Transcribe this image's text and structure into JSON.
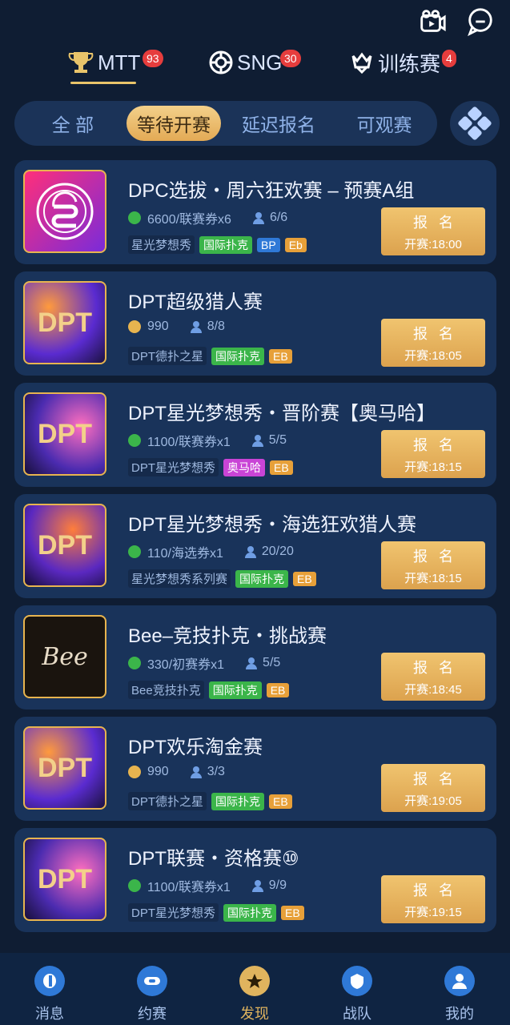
{
  "top": {
    "icons": [
      "camera-icon",
      "message-icon"
    ]
  },
  "tabs": [
    {
      "label": "MTT",
      "badge": "93"
    },
    {
      "label": "SNG",
      "badge": "30"
    },
    {
      "label": "训练赛",
      "badge": "4"
    }
  ],
  "filters": [
    "全  部",
    "等待开赛",
    "延迟报名",
    "可观赛"
  ],
  "cards": [
    {
      "title": "DPC选拔・周六狂欢赛 – 预赛A组",
      "meta": "6600/联赛券x6",
      "people": "6/6",
      "org": "星光梦想秀",
      "tags": [
        "国际扑克",
        "BP",
        "Eb"
      ],
      "btn": "报名",
      "time": "开赛:18:00"
    },
    {
      "title": "DPT超级猎人赛",
      "meta": "990",
      "people": "8/8",
      "org": "DPT德扑之星",
      "tags": [
        "国际扑克",
        "EB"
      ],
      "btn": "报名",
      "time": "开赛:18:05"
    },
    {
      "title": "DPT星光梦想秀・晋阶赛【奥马哈】",
      "meta": "1100/联赛券x1",
      "people": "5/5",
      "org": "DPT星光梦想秀",
      "tags": [
        "奥马哈",
        "EB"
      ],
      "btn": "报名",
      "time": "开赛:18:15"
    },
    {
      "title": "DPT星光梦想秀・海选狂欢猎人赛",
      "meta": "110/海选券x1",
      "people": "20/20",
      "org": "星光梦想秀系列赛",
      "tags": [
        "国际扑克",
        "EB"
      ],
      "btn": "报名",
      "time": "开赛:18:15"
    },
    {
      "title": "Bee–竞技扑克・挑战赛",
      "meta": "330/初赛券x1",
      "people": "5/5",
      "org": "Bee竞技扑克",
      "tags": [
        "国际扑克",
        "EB"
      ],
      "btn": "报名",
      "time": "开赛:18:45"
    },
    {
      "title": "DPT欢乐淘金赛",
      "meta": "990",
      "people": "3/3",
      "org": "DPT德扑之星",
      "tags": [
        "国际扑克",
        "EB"
      ],
      "btn": "报名",
      "time": "开赛:19:05"
    },
    {
      "title": "DPT联赛・资格赛⑩",
      "meta": "1100/联赛券x1",
      "people": "9/9",
      "org": "DPT星光梦想秀",
      "tags": [
        "国际扑克",
        "EB"
      ],
      "btn": "报名",
      "time": "开赛:19:15"
    }
  ],
  "nav": [
    {
      "label": "消息"
    },
    {
      "label": "约赛"
    },
    {
      "label": "发现"
    },
    {
      "label": "战队"
    },
    {
      "label": "我的"
    }
  ],
  "colors": {
    "bg": "#0f1d33",
    "card": "#19335a",
    "accent": "#e0b45e",
    "green": "#3bb54a",
    "blue": "#2f79d7",
    "magenta": "#c944d6",
    "orange": "#e7a039"
  }
}
